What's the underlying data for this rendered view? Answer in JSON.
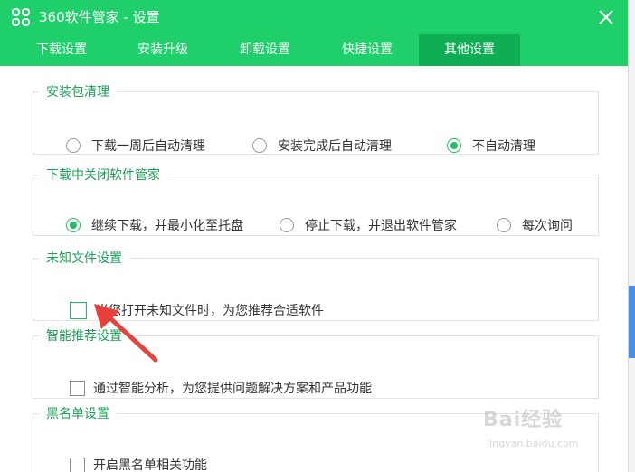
{
  "window": {
    "title": "360软件管家 - 设置"
  },
  "tabs": [
    {
      "label": "下载设置"
    },
    {
      "label": "安装升级"
    },
    {
      "label": "卸载设置"
    },
    {
      "label": "快捷设置"
    },
    {
      "label": "其他设置",
      "active": true
    }
  ],
  "groups": {
    "package_cleanup": {
      "title": "安装包清理",
      "options": [
        {
          "label": "下载一周后自动清理",
          "checked": false
        },
        {
          "label": "安装完成后自动清理",
          "checked": false
        },
        {
          "label": "不自动清理",
          "checked": true
        }
      ]
    },
    "close_during_download": {
      "title": "下载中关闭软件管家",
      "options": [
        {
          "label": "继续下载，并最小化至托盘",
          "checked": true
        },
        {
          "label": "停止下载，并退出软件管家",
          "checked": false
        },
        {
          "label": "每次询问",
          "checked": false
        }
      ]
    },
    "unknown_file": {
      "title": "未知文件设置",
      "checkbox": {
        "label": "当您打开未知文件时，为您推荐合适软件",
        "checked": false
      }
    },
    "smart_recommend": {
      "title": "智能推荐设置",
      "checkbox": {
        "label": "通过智能分析，为您提供问题解决方案和产品功能",
        "checked": false
      }
    },
    "blacklist": {
      "title": "黑名单设置",
      "checkbox": {
        "label": "开启黑名单相关功能",
        "checked": false
      }
    }
  },
  "watermark": {
    "brand": "Bai经验",
    "url": "jingyan.baidu.com"
  },
  "colors": {
    "accent": "#1fcf6a",
    "active_tab": "#0fae55",
    "group_title": "#1a9f55",
    "annotation_arrow": "#e8403a"
  }
}
